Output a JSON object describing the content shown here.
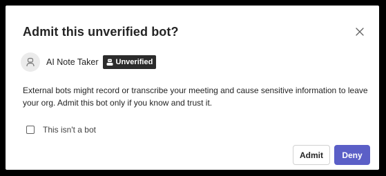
{
  "dialog": {
    "title": "Admit this unverified bot?",
    "close_icon": "close-icon"
  },
  "bot": {
    "avatar_icon": "bot-avatar-icon",
    "name": "AI Note Taker",
    "badge_icon": "unverified-icon",
    "badge_label": "Unverified"
  },
  "message": "External bots might record or transcribe your meeting and cause sensitive information to leave your org. Admit this bot only if you know and trust it.",
  "checkbox": {
    "label": "This isn't a bot",
    "checked": false
  },
  "actions": {
    "admit_label": "Admit",
    "deny_label": "Deny"
  },
  "colors": {
    "primary": "#5b5fc7",
    "badge_bg": "#2b2b2b",
    "text": "#242424"
  }
}
